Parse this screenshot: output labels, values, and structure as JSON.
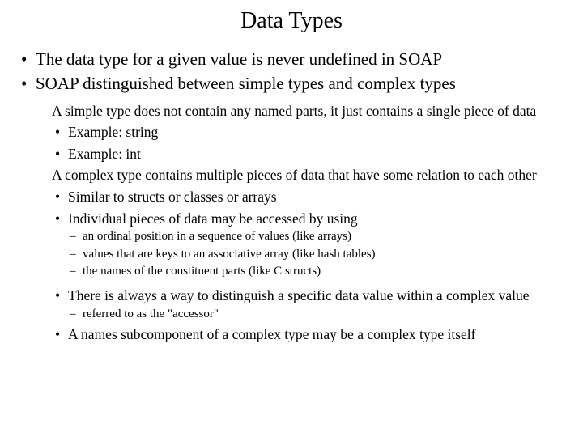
{
  "title": "Data Types",
  "l1": [
    "The data type for a given value is never undefined in SOAP",
    "SOAP distinguished between simple types and complex types"
  ],
  "l2": [
    "A simple type does not contain any named parts, it just contains a single piece of data",
    "A complex type contains multiple pieces of data that have some relation to each other"
  ],
  "simple_examples": [
    "Example: string",
    "Example: int"
  ],
  "complex_points": [
    "Similar to structs or classes or arrays",
    "Individual pieces of data may be accessed by using"
  ],
  "access_methods": [
    "an ordinal position in a sequence of values (like arrays)",
    "values that are keys to an associative array (like hash tables)",
    "the names of the constituent parts (like C structs)"
  ],
  "after_points": [
    "There is always a way to distinguish a specific data value within a complex value",
    "A names subcomponent of a complex type may be a complex type itself"
  ],
  "accessor_note": "referred to as the \"accessor\""
}
